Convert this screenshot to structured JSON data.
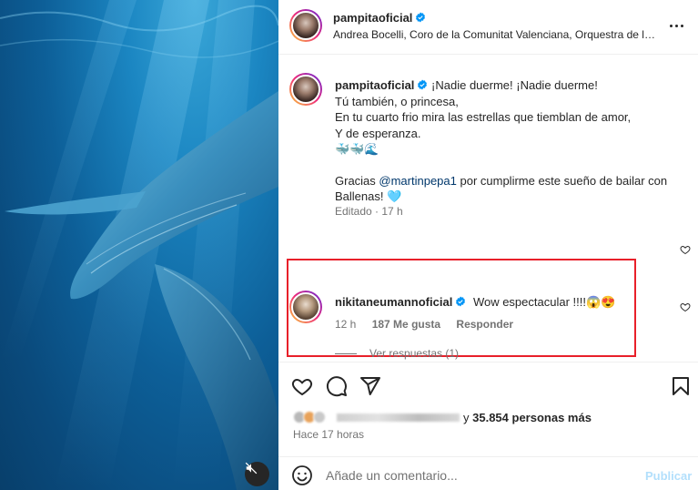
{
  "post": {
    "author": "pampitaoficial",
    "song": "Andrea Bocelli, Coro de la Comunitat Valenciana, Orquestra de la Comunitat Valenciana · Nessun dorma",
    "caption_author": "pampitaoficial",
    "caption_lines": [
      "¡Nadie duerme! ¡Nadie duerme!",
      "Tú también, o princesa,",
      "En tu cuarto frio mira las estrellas que tiemblan de amor,",
      "Y de esperanza.",
      "🐳🐳🌊"
    ],
    "thanks_prefix": "Gracias ",
    "thanks_mention": "@martinpepa1",
    "thanks_suffix": " por cumplirme este sueño de bailar con",
    "thanks_line2": "Ballenas! 🩵",
    "caption_meta": "Editado · 17 h"
  },
  "comment": {
    "author": "nikitaneumannoficial",
    "text": "Wow espectacular !!!!😱😍",
    "time": "12 h",
    "likes": "187 Me gusta",
    "reply_label": "Responder",
    "view_replies": "Ver respuestas (1)"
  },
  "likes": {
    "suffix": "y ",
    "count": "35.854 personas más"
  },
  "time_ago": "Hace 17 horas",
  "composer": {
    "placeholder": "Añade un comentario...",
    "publish_label": "Publicar"
  },
  "icons": {
    "more": "more-options-icon",
    "like": "heart-icon",
    "comment": "comment-icon",
    "share": "share-icon",
    "save": "bookmark-icon",
    "emoji": "emoji-icon",
    "mute": "muted-speaker-icon",
    "verified": "verified-badge-icon"
  },
  "colors": {
    "accent": "#0095f6",
    "verified": "#0095f6",
    "highlight_box": "#e8202a",
    "publish_disabled": "#b2dffc",
    "ocean": "#1b86c2"
  }
}
